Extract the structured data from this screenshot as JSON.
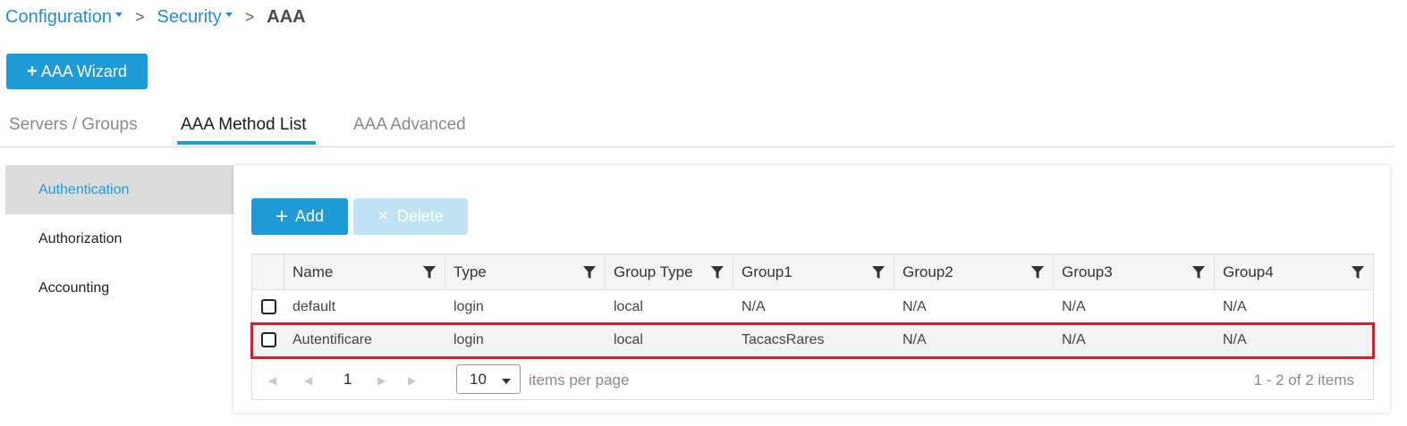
{
  "breadcrumb": {
    "item1": "Configuration",
    "item2": "Security",
    "separator": ">",
    "current": "AAA"
  },
  "wizard_button": {
    "icon": "+",
    "label": "AAA Wizard"
  },
  "tabs": [
    {
      "label": "Servers / Groups",
      "active": false
    },
    {
      "label": "AAA Method List",
      "active": true
    },
    {
      "label": "AAA Advanced",
      "active": false
    }
  ],
  "sidenav": [
    {
      "label": "Authentication",
      "active": true
    },
    {
      "label": "Authorization",
      "active": false
    },
    {
      "label": "Accounting",
      "active": false
    }
  ],
  "toolbar": {
    "add_icon": "+",
    "add_label": "Add",
    "delete_icon": "×",
    "delete_label": "Delete"
  },
  "table": {
    "columns": [
      "Name",
      "Type",
      "Group Type",
      "Group1",
      "Group2",
      "Group3",
      "Group4"
    ],
    "rows": [
      [
        "default",
        "login",
        "local",
        "N/A",
        "N/A",
        "N/A",
        "N/A"
      ],
      [
        "Autentificare",
        "login",
        "local",
        "TacacsRares",
        "N/A",
        "N/A",
        "N/A"
      ]
    ]
  },
  "pager": {
    "page": "1",
    "page_size": "10",
    "items_label": "items per page",
    "info": "1 - 2 of 2 items"
  },
  "colors": {
    "accent": "#1e9ad6",
    "link": "#1f8dd6",
    "highlight": "#d3202f",
    "disabled": "#bfe3f3"
  }
}
